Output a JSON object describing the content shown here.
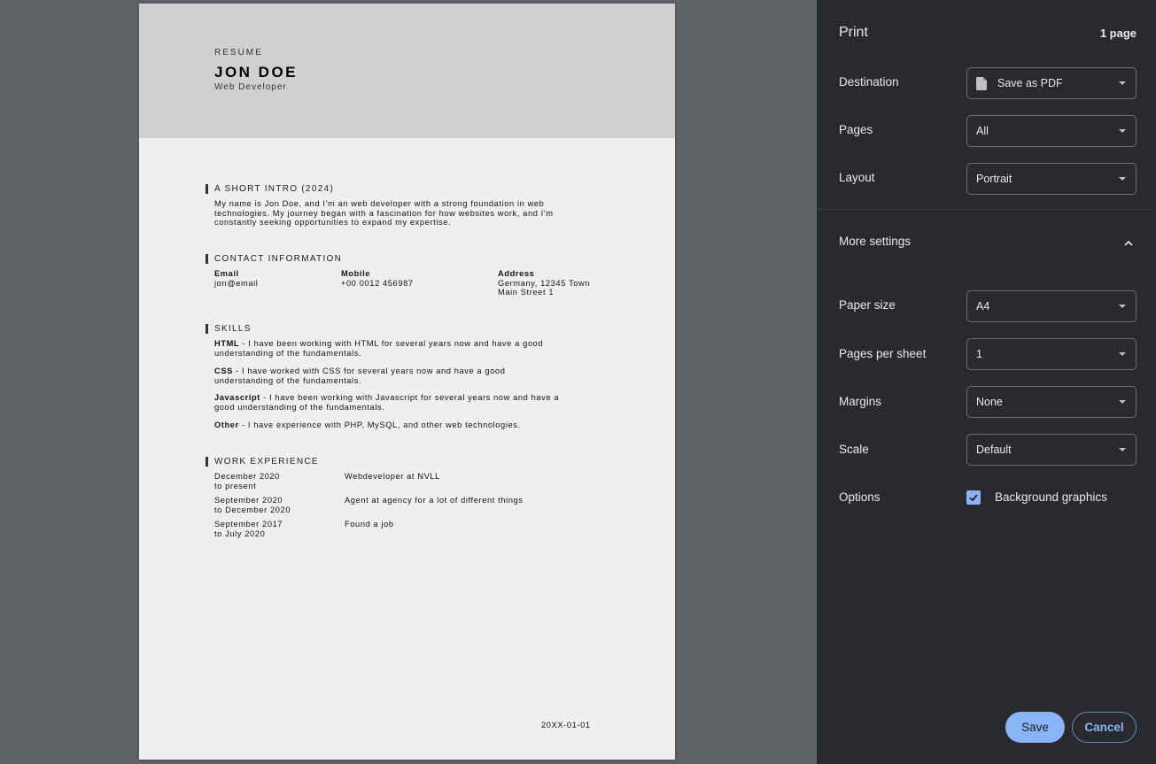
{
  "resume": {
    "label": "RESUME",
    "name": "JON DOE",
    "role": "Web Developer",
    "intro": {
      "title": "A SHORT INTRO (2024)",
      "line1": "My name is Jon Doe, and I'm an web developer with a strong foundation in web",
      "line2": "technologies. My journey began with a fascination for how websites work, and I'm",
      "line3": "constantly seeking opportunities to expand my expertise."
    },
    "contact": {
      "title": "CONTACT INFORMATION",
      "email_label": "Email",
      "email_value": "jon@email",
      "mobile_label": "Mobile",
      "mobile_value": "+00 0012 456987",
      "address_label": "Address",
      "address_line1": "Germany, 12345 Town",
      "address_line2": "Main Street 1"
    },
    "skills": {
      "title": "SKILLS",
      "items": [
        {
          "name": "HTML",
          "line1": " - I have been working with HTML for several years now and have a good",
          "line2": "understanding of the fundamentals."
        },
        {
          "name": "CSS",
          "line1": " - I have worked with CSS for several years now and have a good",
          "line2": "understanding of the fundamentals."
        },
        {
          "name": "Javascript",
          "line1": " - I have been working with Javascript for several years now and have a",
          "line2": "good understanding of the fundamentals."
        },
        {
          "name": "Other",
          "line1": " - I have experience with PHP, MySQL, and other web technologies.",
          "line2": ""
        }
      ]
    },
    "work": {
      "title": "WORK EXPERIENCE",
      "items": [
        {
          "from": "December 2020",
          "to": "to present",
          "desc": "Webdeveloper at NVLL"
        },
        {
          "from": "September 2020",
          "to": "to December 2020",
          "desc": "Agent at agency for a lot of different things"
        },
        {
          "from": "September 2017",
          "to": "to July 2020",
          "desc": "Found a job"
        }
      ]
    },
    "footer_date": "20XX-01-01"
  },
  "print": {
    "title": "Print",
    "page_count": "1 page",
    "destination": {
      "label": "Destination",
      "value": "Save as PDF"
    },
    "pages": {
      "label": "Pages",
      "value": "All"
    },
    "layout": {
      "label": "Layout",
      "value": "Portrait"
    },
    "more_settings": "More settings",
    "paper_size": {
      "label": "Paper size",
      "value": "A4"
    },
    "pages_per_sheet": {
      "label": "Pages per sheet",
      "value": "1"
    },
    "margins": {
      "label": "Margins",
      "value": "None"
    },
    "scale": {
      "label": "Scale",
      "value": "Default"
    },
    "options": {
      "label": "Options",
      "background_graphics": "Background graphics",
      "background_graphics_checked": true
    },
    "save_label": "Save",
    "cancel_label": "Cancel"
  },
  "colors": {
    "sidebar_bg": "#292a2d",
    "accent": "#8ab4f8",
    "preview_bg": "#5f6368"
  }
}
